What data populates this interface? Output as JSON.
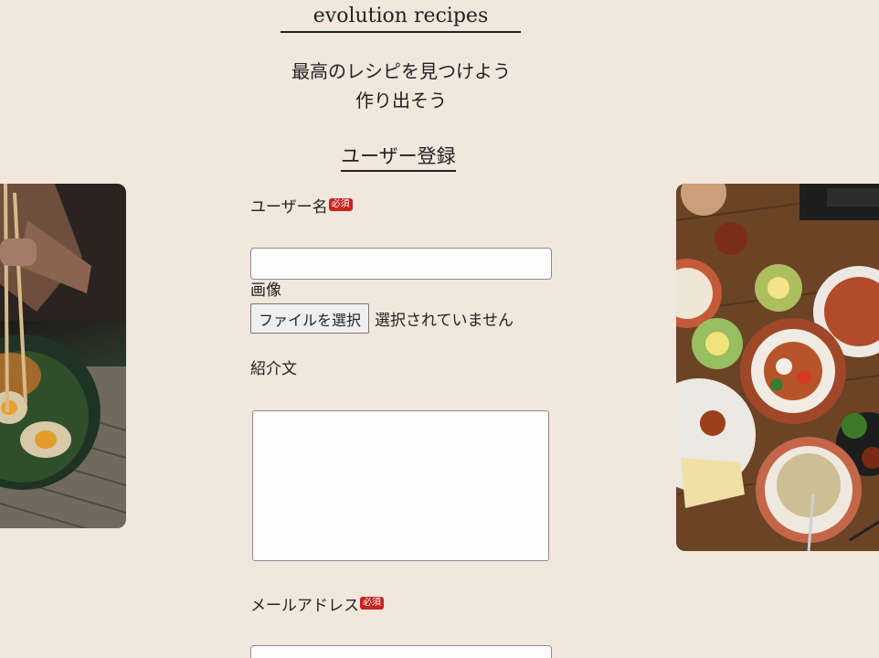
{
  "header": {
    "site_title": "evolution recipes",
    "tagline_line1": "最高のレシピを見つけよう",
    "tagline_line2": "作り出そう"
  },
  "form": {
    "section_title": "ユーザー登録",
    "required_badge": "必須",
    "username": {
      "label": "ユーザー名",
      "value": ""
    },
    "image": {
      "label": "画像",
      "button_label": "ファイルを選択",
      "status": "選択されていません"
    },
    "bio": {
      "label": "紹介文",
      "value": ""
    },
    "email": {
      "label": "メールアドレス",
      "value": ""
    }
  },
  "images": {
    "left": "ramen-bowl-with-chopsticks-photo",
    "right": "table-spread-of-dishes-photo"
  },
  "colors": {
    "background": "#f1e7dd",
    "required_badge": "#c8231e"
  }
}
